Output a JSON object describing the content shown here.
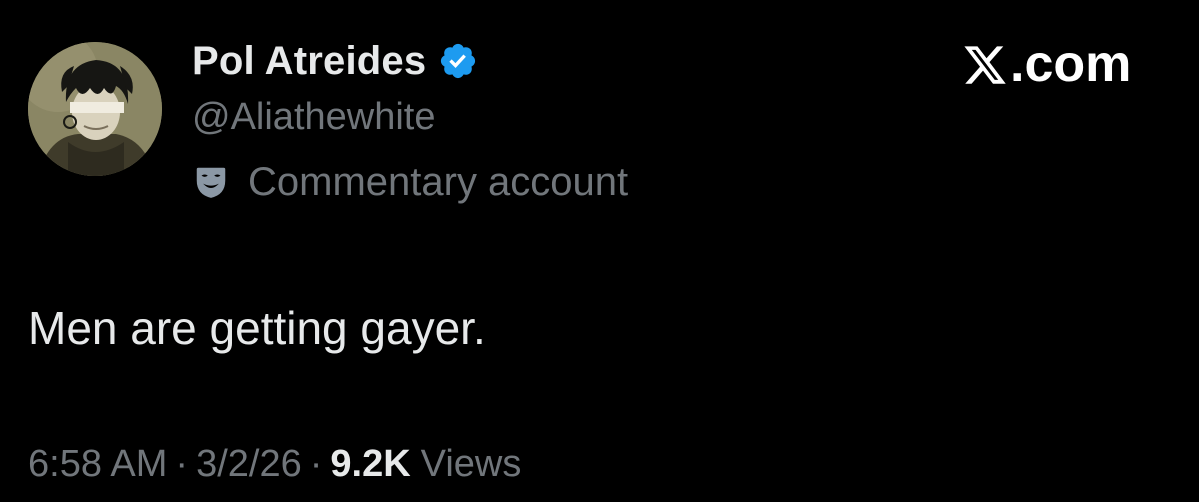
{
  "profile": {
    "display_name": "Pol Atreides",
    "handle": "@Aliathewhite",
    "account_label": "Commentary account",
    "avatar_icon": "avatar-illustration",
    "verified_icon": "verified-badge-icon",
    "label_icon": "theater-mask-icon"
  },
  "brand": {
    "text": ".com",
    "logo_icon": "x-logo-icon"
  },
  "tweet": {
    "text": "Men are getting gayer."
  },
  "meta": {
    "time": "6:58 AM",
    "separator": "·",
    "date": "3/2/26",
    "views_count": "9.2K",
    "views_label": "Views"
  },
  "colors": {
    "background": "#000000",
    "primary_text": "#e7e9ea",
    "secondary_text": "#71767b",
    "verified_blue": "#1d9bf0"
  }
}
